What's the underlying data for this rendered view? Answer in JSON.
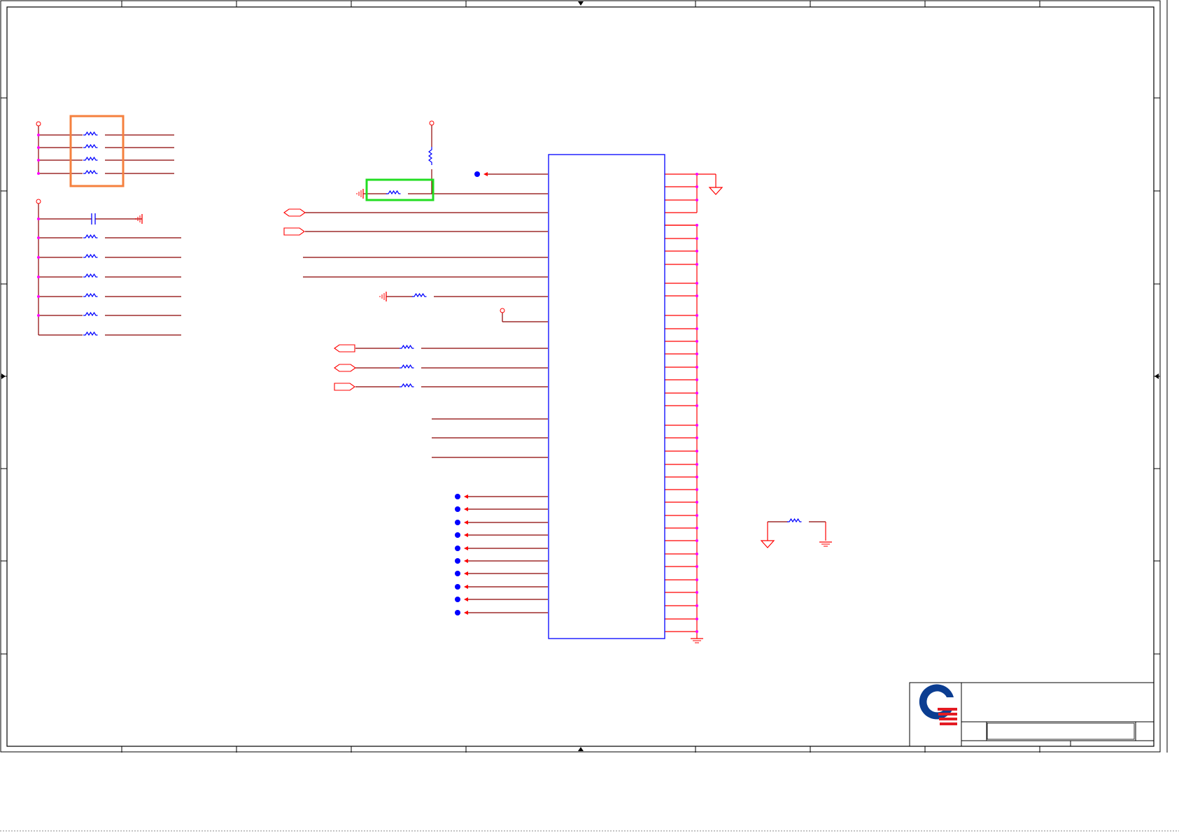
{
  "colors": {
    "frame": "#000000",
    "wire": "#8b0000",
    "pin": "#ff0000",
    "component": "#0000ff",
    "junction": "#ff00ff",
    "connector_dot": "#0000ff",
    "highlight_orange": "#f5803e",
    "highlight_green": "#22dd22",
    "logo_blue": "#0b3d91",
    "logo_red": "#e31b23"
  },
  "icons": {
    "logo": "company-logo-icon",
    "ground": "ground-icon",
    "chassis_ground": "chassis-ground-icon",
    "power": "power-flag-icon",
    "offpage": "offpage-connector-icon"
  }
}
